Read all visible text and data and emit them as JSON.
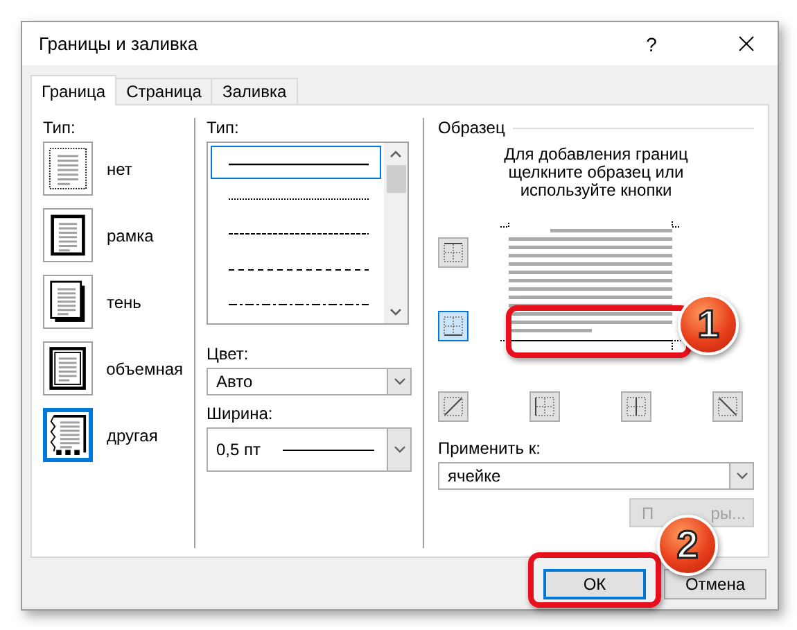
{
  "window": {
    "title": "Границы и заливка",
    "help": "?"
  },
  "tabs": [
    {
      "label": "Граница",
      "selected": true
    },
    {
      "label": "Страница",
      "selected": false
    },
    {
      "label": "Заливка",
      "selected": false
    }
  ],
  "setting": {
    "label": "Тип:",
    "items": [
      {
        "label": "нет",
        "kind": "none",
        "selected": false
      },
      {
        "label": "рамка",
        "kind": "box",
        "selected": false
      },
      {
        "label": "тень",
        "kind": "shadow",
        "selected": false
      },
      {
        "label": "объемная",
        "kind": "volume",
        "selected": false
      },
      {
        "label": "другая",
        "kind": "custom",
        "selected": true
      }
    ]
  },
  "style": {
    "label": "Тип:",
    "options": [
      {
        "kind": "solid",
        "selected": true
      },
      {
        "kind": "dotted",
        "selected": false
      },
      {
        "kind": "fine-dash",
        "selected": false
      },
      {
        "kind": "dashed",
        "selected": false
      },
      {
        "kind": "dash-dot",
        "selected": false
      }
    ]
  },
  "color": {
    "label": "Цвет:",
    "value": "Авто"
  },
  "width": {
    "label": "Ширина:",
    "value": "0,5 пт"
  },
  "preview": {
    "title": "Образец",
    "hint": "Для добавления границ щелкните образец или используйте кнопки",
    "buttons": [
      {
        "kind": "top",
        "on": false
      },
      {
        "kind": "bottom",
        "on": true
      },
      {
        "kind": "diag-up",
        "on": false
      },
      {
        "kind": "vertical",
        "on": false
      },
      {
        "kind": "inside",
        "on": false
      },
      {
        "kind": "diag-down",
        "on": false
      }
    ]
  },
  "apply": {
    "label": "Применить к:",
    "value": "ячейке"
  },
  "options_button": {
    "label_parts": [
      "П",
      "ры..."
    ],
    "disabled": true
  },
  "buttons": [
    {
      "label": "ОК",
      "default": true
    },
    {
      "label": "Отмена",
      "default": false
    }
  ],
  "callouts": [
    {
      "number": "1"
    },
    {
      "number": "2"
    }
  ]
}
